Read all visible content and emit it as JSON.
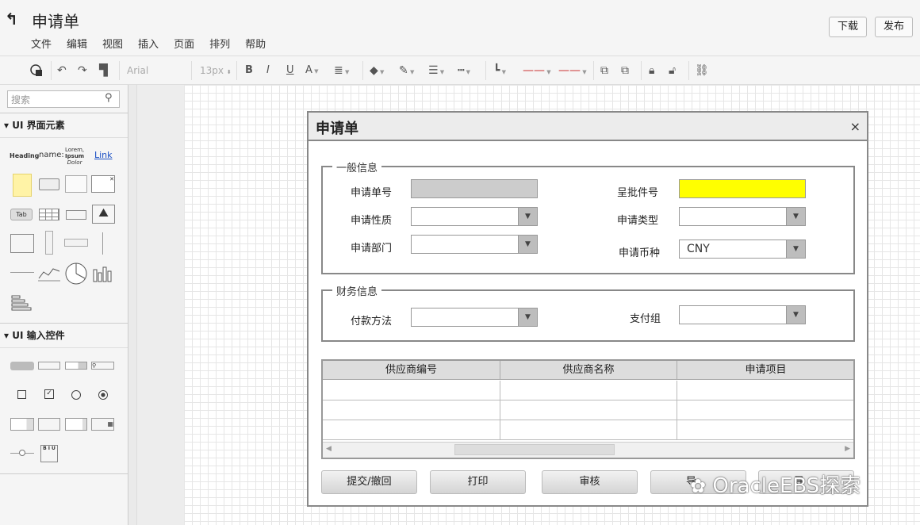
{
  "app": {
    "title": "申请单",
    "back_icon": "back-arrow-icon"
  },
  "menu": [
    "文件",
    "编辑",
    "视图",
    "插入",
    "页面",
    "排列",
    "帮助"
  ],
  "header_buttons": {
    "download": "下载",
    "publish": "发布"
  },
  "toolbar": {
    "font": "Arial",
    "size": "13px"
  },
  "sidebar": {
    "search_placeholder": "搜索",
    "section1": "UI 界面元素",
    "section2": "UI 输入控件",
    "heading": "Heading",
    "name": "name:",
    "lorem": [
      "Lorem,",
      "Ipsum",
      "Dolor"
    ],
    "link": "Link",
    "tab": "Tab",
    "biu": "B I U"
  },
  "dialog": {
    "title": "申请单",
    "close": "×",
    "general": {
      "label": "一般信息",
      "fields": {
        "req_no": {
          "label": "申请单号",
          "value": ""
        },
        "approval_no": {
          "label": "呈批件号",
          "value": ""
        },
        "nature": {
          "label": "申请性质",
          "value": ""
        },
        "type": {
          "label": "申请类型",
          "value": ""
        },
        "dept": {
          "label": "申请部门",
          "value": ""
        },
        "currency": {
          "label": "申请币种",
          "value": "CNY"
        }
      }
    },
    "finance": {
      "label": "财务信息",
      "fields": {
        "pay_method": {
          "label": "付款方法",
          "value": ""
        },
        "pay_group": {
          "label": "支付组",
          "value": ""
        }
      }
    },
    "table": {
      "columns": [
        "供应商编号",
        "供应商名称",
        "申请项目"
      ],
      "rows": [
        [
          "",
          "",
          ""
        ],
        [
          "",
          "",
          ""
        ],
        [
          "",
          "",
          ""
        ]
      ]
    },
    "actions": [
      "提交/撤回",
      "打印",
      "审核",
      "导",
      "导"
    ]
  },
  "colors": {
    "highlight": "#ffff00",
    "accent_link": "#1a4fc4"
  },
  "watermark": "OracleEBS探索"
}
